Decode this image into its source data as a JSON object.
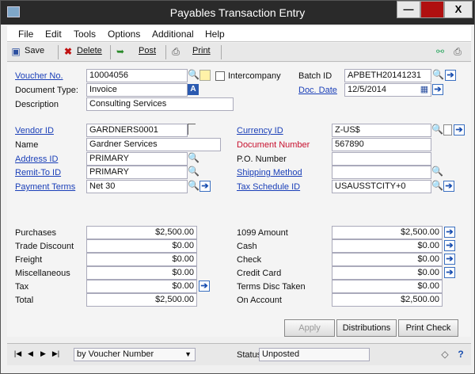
{
  "window": {
    "title": "Payables Transaction Entry",
    "minimize": "—",
    "maximize": "□",
    "close": "X"
  },
  "menu": [
    "File",
    "Edit",
    "Tools",
    "Options",
    "Additional",
    "Help"
  ],
  "toolbar": {
    "save": "Save",
    "delete": "Delete",
    "post": "Post",
    "print": "Print"
  },
  "header": {
    "voucher_label": "Voucher No.",
    "voucher_value": "10004056",
    "intercompany_label": "Intercompany",
    "batch_label": "Batch ID",
    "batch_value": "APBETH20141231",
    "doctype_label": "Document Type:",
    "doctype_value": "Invoice",
    "docdate_label": "Doc. Date",
    "docdate_value": "12/5/2014",
    "description_label": "Description",
    "description_value": "Consulting Services"
  },
  "vendor": {
    "vendor_label": "Vendor ID",
    "vendor_value": "GARDNERS0001",
    "name_label": "Name",
    "name_value": "Gardner Services",
    "address_label": "Address ID",
    "address_value": "PRIMARY",
    "remit_label": "Remit-To ID",
    "remit_value": "PRIMARY",
    "terms_label": "Payment Terms",
    "terms_value": "Net 30",
    "currency_label": "Currency ID",
    "currency_value": "Z-US$",
    "docnum_label": "Document Number",
    "docnum_value": "567890",
    "po_label": "P.O. Number",
    "po_value": "",
    "shipping_label": "Shipping Method",
    "shipping_value": "",
    "taxsched_label": "Tax Schedule ID",
    "taxsched_value": "USAUSSTCITY+0"
  },
  "amounts_left": [
    {
      "label": "Purchases",
      "value": "$2,500.00"
    },
    {
      "label": "Trade Discount",
      "value": "$0.00"
    },
    {
      "label": "Freight",
      "value": "$0.00"
    },
    {
      "label": "Miscellaneous",
      "value": "$0.00"
    },
    {
      "label": "Tax",
      "value": "$0.00"
    },
    {
      "label": "Total",
      "value": "$2,500.00"
    }
  ],
  "amounts_right": [
    {
      "label": "1099 Amount",
      "value": "$2,500.00"
    },
    {
      "label": "Cash",
      "value": "$0.00"
    },
    {
      "label": "Check",
      "value": "$0.00"
    },
    {
      "label": "Credit Card",
      "value": "$0.00"
    },
    {
      "label": "Terms Disc Taken",
      "value": "$0.00"
    },
    {
      "label": "On Account",
      "value": "$2,500.00"
    }
  ],
  "buttons": {
    "apply": "Apply",
    "distributions": "Distributions",
    "print_check": "Print Check"
  },
  "statusbar": {
    "sort_value": "by Voucher Number",
    "status_label": "Status",
    "status_value": "Unposted"
  },
  "colors": {
    "required_label": "#c8102e",
    "link_label": "#1a3fb8"
  }
}
